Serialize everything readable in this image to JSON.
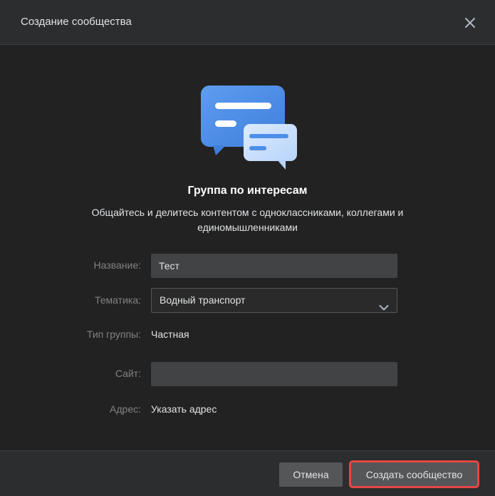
{
  "dialog": {
    "title": "Создание сообщества",
    "close_icon": "close-icon"
  },
  "intro": {
    "illustration_icon": "chat-bubbles-icon",
    "heading": "Группа по интересам",
    "description": "Общайтесь и делитесь контентом с одноклассниками, коллегами и единомышленниками"
  },
  "form": {
    "name": {
      "label": "Название:",
      "value": "Тест"
    },
    "topic": {
      "label": "Тематика:",
      "value": "Водный транспорт",
      "icon": "chevron-down-icon"
    },
    "group_type": {
      "label": "Тип группы:",
      "value": "Частная"
    },
    "site": {
      "label": "Сайт:",
      "value": ""
    },
    "address": {
      "label": "Адрес:",
      "value": "Указать адрес"
    }
  },
  "footer": {
    "cancel_label": "Отмена",
    "create_label": "Создать сообщество"
  },
  "colors": {
    "background": "#222222",
    "header": "#2c2d2e",
    "button": "#555657",
    "highlight": "#e64646",
    "illustration_blue": "#4d8fe8"
  }
}
